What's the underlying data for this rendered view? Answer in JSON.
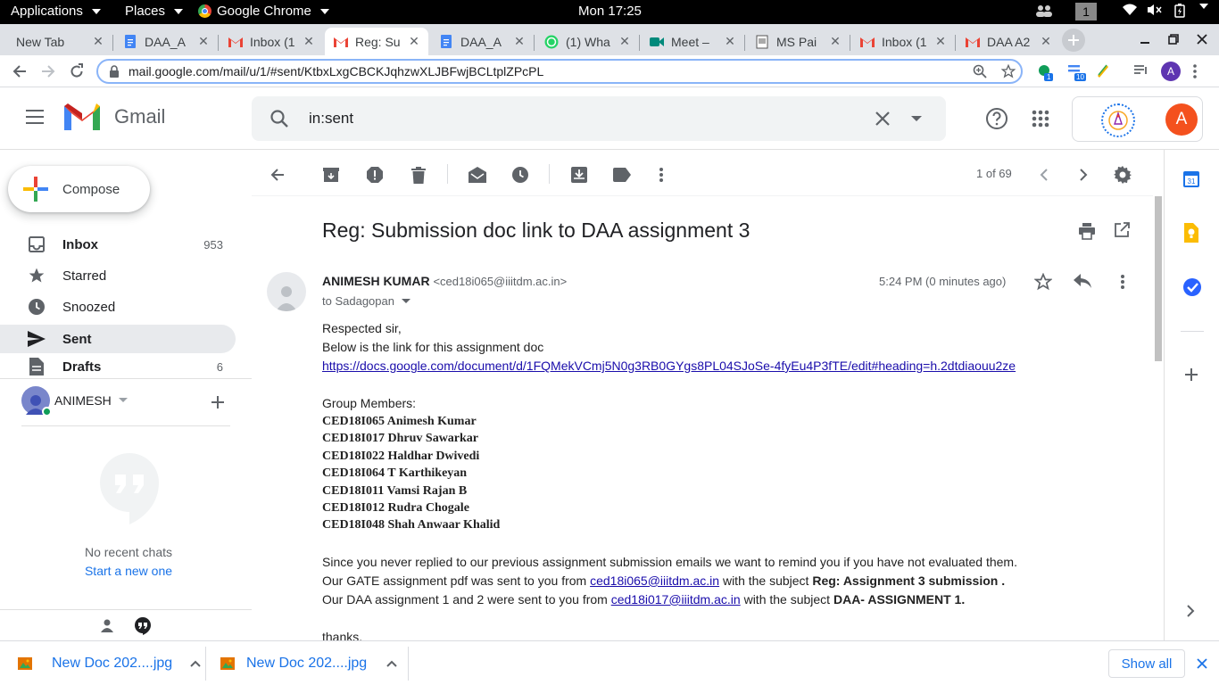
{
  "system_bar": {
    "applications": "Applications",
    "places": "Places",
    "browser": "Google Chrome",
    "clock": "Mon 17:25",
    "workspace": "1"
  },
  "tabs": [
    {
      "label": "New Tab",
      "icon": "none"
    },
    {
      "label": "DAA_A",
      "icon": "docs-icon"
    },
    {
      "label": "Inbox (1",
      "icon": "gmail-icon"
    },
    {
      "label": "Reg: Su",
      "icon": "gmail-icon",
      "active": true
    },
    {
      "label": "DAA_A",
      "icon": "docs-icon"
    },
    {
      "label": "(1) Wha",
      "icon": "whatsapp-icon"
    },
    {
      "label": "Meet – ",
      "icon": "meet-icon"
    },
    {
      "label": "MS Pai",
      "icon": "page-icon"
    },
    {
      "label": "Inbox (1",
      "icon": "gmail-icon"
    },
    {
      "label": "DAA A2",
      "icon": "gmail-icon"
    }
  ],
  "address": {
    "url": "mail.google.com/mail/u/1/#sent/KtbxLxgCBCKJqhzwXLJBFwjBCLtplZPcPL",
    "ext_badge_1": "1",
    "ext_badge_2": "10",
    "profile_initial": "A"
  },
  "gmail": {
    "logo_text": "Gmail",
    "search_value": "in:sent",
    "account_initial": "A"
  },
  "sidebar": {
    "compose": "Compose",
    "items": [
      {
        "label": "Inbox",
        "count": "953",
        "icon": "inbox-icon"
      },
      {
        "label": "Starred",
        "count": "",
        "icon": "star-icon"
      },
      {
        "label": "Snoozed",
        "count": "",
        "icon": "clock-icon"
      },
      {
        "label": "Sent",
        "count": "",
        "icon": "send-icon"
      },
      {
        "label": "Drafts",
        "count": "6",
        "icon": "draft-icon"
      }
    ],
    "chat_user": "ANIMESH",
    "no_chats": "No recent chats",
    "start_new": "Start a new one"
  },
  "toolbar": {
    "pagination": "1 of 69"
  },
  "message": {
    "subject": "Reg: Submission doc link to DAA assignment 3",
    "sender_name": "ANIMESH KUMAR",
    "sender_email": "<ced18i065@iiitdm.ac.in>",
    "time": "5:24 PM (0 minutes ago)",
    "to": "to Sadagopan",
    "greeting": "Respected sir,",
    "line1": "Below is the link for this assignment doc",
    "link": "https://docs.google.com/document/d/1FQMekVCmj5N0g3RB0GYgs8PL04SJoSe-4fyEu4P3fTE/edit#heading=h.2dtdiaouu2ze",
    "group_heading": "Group Members:",
    "members": [
      "CED18I065 Animesh Kumar",
      "CED18I017 Dhruv Sawarkar",
      "CED18I022 Haldhar Dwivedi",
      "CED18I064 T Karthikeyan",
      "CED18I011 Vamsi Rajan B",
      "CED18I012 Rudra Chogale",
      "CED18I048 Shah Anwaar Khalid"
    ],
    "para1": "Since you never replied to our previous assignment submission emails we want to remind you if you have not evaluated them.",
    "para2_pre": "Our GATE assignment pdf was sent to you from ",
    "para2_link": "ced18i065@iiitdm.ac.in",
    "para2_mid": " with the subject ",
    "para2_bold": "Reg: Assignment 3 submission .",
    "para3_pre": "Our DAA assignment 1 and 2 were sent to you from ",
    "para3_link": "ced18i017@iiitdm.ac.in",
    "para3_mid": " with the subject ",
    "para3_bold": "DAA- ASSIGNMENT 1.",
    "closing": "thanks,"
  },
  "downloads": {
    "items": [
      "New Doc 202....jpg",
      "New Doc 202....jpg"
    ],
    "show_all": "Show all"
  },
  "colors": {
    "accent_blue": "#1a73e8",
    "gmail_red": "#ea4335",
    "link": "#1a0dab"
  }
}
